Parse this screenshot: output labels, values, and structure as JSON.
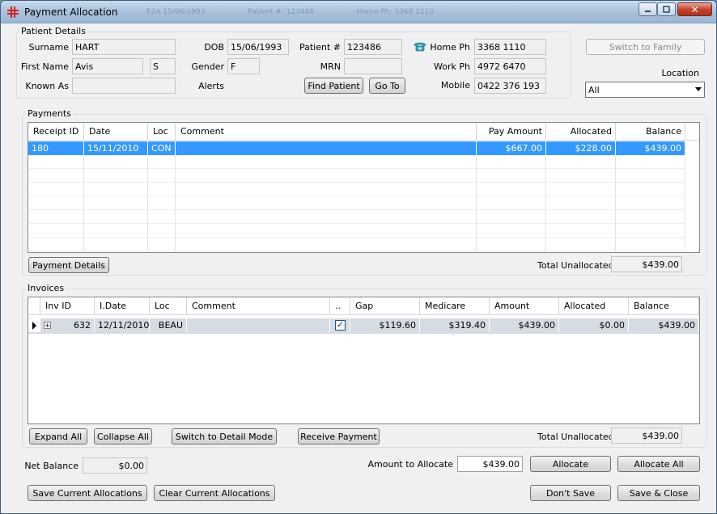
{
  "window": {
    "title": "Payment Allocation",
    "ghost_texts": [
      "E2A 15/06/1993",
      "Patient #: 123486",
      "Home Ph: 3368 1110"
    ]
  },
  "patient": {
    "group_title": "Patient Details",
    "surname_label": "Surname",
    "surname": "HART",
    "firstname_label": "First Name",
    "firstname": "Avis",
    "initial": "S",
    "knownas_label": "Known As",
    "knownas": "",
    "dob_label": "DOB",
    "dob": "15/06/1993",
    "gender_label": "Gender",
    "gender": "F",
    "alerts_label": "Alerts",
    "patientno_label": "Patient #",
    "patientno": "123486",
    "mrn_label": "MRN",
    "mrn": "",
    "find_patient": "Find Patient",
    "go_to": "Go To",
    "homeph_label": "Home Ph",
    "homeph": "3368 1110",
    "workph_label": "Work Ph",
    "workph": "4972 6470",
    "mobile_label": "Mobile",
    "mobile": "0422 376 193"
  },
  "switch_family": "Switch to Family",
  "location": {
    "label": "Location",
    "value": "All"
  },
  "payments": {
    "group_title": "Payments",
    "columns": [
      "Receipt ID",
      "Date",
      "Loc",
      "Comment",
      "Pay Amount",
      "Allocated",
      "Balance"
    ],
    "rows": [
      {
        "receipt_id": "180",
        "date": "15/11/2010",
        "loc": "CON",
        "comment": "",
        "pay_amount": "$667.00",
        "allocated": "$228.00",
        "balance": "$439.00"
      }
    ],
    "details_button": "Payment Details",
    "total_label": "Total Unallocated",
    "total": "$439.00"
  },
  "invoices": {
    "group_title": "Invoices",
    "columns": [
      "Inv ID",
      "I.Date",
      "Loc",
      "Comment",
      "..",
      "Gap",
      "Medicare",
      "Amount",
      "Allocated",
      "Balance"
    ],
    "rows": [
      {
        "inv_id": "632",
        "date": "12/11/2010",
        "loc": "BEAU",
        "comment": "",
        "checked": "✓",
        "gap": "$119.60",
        "medicare": "$319.40",
        "amount": "$439.00",
        "allocated": "$0.00",
        "balance": "$439.00"
      }
    ],
    "expand_all": "Expand All",
    "collapse_all": "Collapse All",
    "switch_detail": "Switch to Detail Mode",
    "receive_payment": "Receive Payment",
    "total_label": "Total Unallocated",
    "total": "$439.00"
  },
  "footer": {
    "net_balance_label": "Net Balance",
    "net_balance": "$0.00",
    "amount_label": "Amount to Allocate",
    "amount": "$439.00",
    "allocate": "Allocate",
    "allocate_all": "Allocate All",
    "save_current": "Save Current Allocations",
    "clear_current": "Clear Current Allocations",
    "dont_save": "Don't Save",
    "save_close": "Save & Close"
  }
}
